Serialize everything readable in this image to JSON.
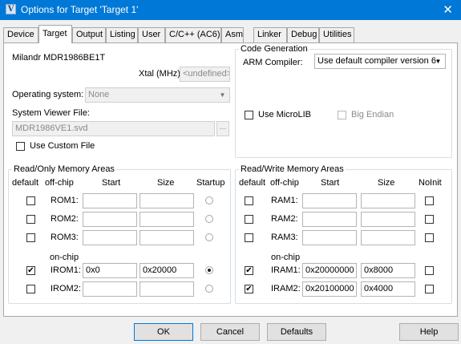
{
  "window": {
    "title": "Options for Target 'Target 1'",
    "close_glyph": "✕",
    "app_icon_letter": "V"
  },
  "tabs": [
    {
      "label": "Device",
      "active": false
    },
    {
      "label": "Target",
      "active": true
    },
    {
      "label": "Output",
      "active": false
    },
    {
      "label": "Listing",
      "active": false
    },
    {
      "label": "User",
      "active": false
    },
    {
      "label": "C/C++ (AC6)",
      "active": false
    },
    {
      "label": "Asm",
      "active": false
    },
    {
      "label": "Linker",
      "active": false
    },
    {
      "label": "Debug",
      "active": false
    },
    {
      "label": "Utilities",
      "active": false
    }
  ],
  "target": {
    "device_name": "Milandr MDR1986BE1T",
    "xtal_label": "Xtal (MHz):",
    "xtal_value": "<undefined>",
    "os_label": "Operating system:",
    "os_value": "None",
    "svd_label": "System Viewer File:",
    "svd_value": "MDR1986VE1.svd",
    "browse_label": "...",
    "use_custom_file_label": "Use Custom File",
    "use_custom_file_checked": false
  },
  "code_generation": {
    "title": "Code Generation",
    "compiler_label": "ARM Compiler:",
    "compiler_value": "Use default compiler version 6",
    "use_microlib_label": "Use MicroLIB",
    "use_microlib_checked": false,
    "big_endian_label": "Big Endian",
    "big_endian_checked": false
  },
  "rom_areas": {
    "title": "Read/Only Memory Areas",
    "headers": {
      "default": "default",
      "offchip": "off-chip",
      "start": "Start",
      "size": "Size",
      "startup": "Startup"
    },
    "on_chip_label": "on-chip",
    "rows": [
      {
        "name": "ROM1:",
        "checked": false,
        "start": "",
        "size": "",
        "startup": false
      },
      {
        "name": "ROM2:",
        "checked": false,
        "start": "",
        "size": "",
        "startup": false
      },
      {
        "name": "ROM3:",
        "checked": false,
        "start": "",
        "size": "",
        "startup": false
      },
      {
        "name": "IROM1:",
        "checked": true,
        "start": "0x0",
        "size": "0x20000",
        "startup": true
      },
      {
        "name": "IROM2:",
        "checked": false,
        "start": "",
        "size": "",
        "startup": false
      }
    ]
  },
  "ram_areas": {
    "title": "Read/Write Memory Areas",
    "headers": {
      "default": "default",
      "offchip": "off-chip",
      "start": "Start",
      "size": "Size",
      "noinit": "NoInit"
    },
    "on_chip_label": "on-chip",
    "rows": [
      {
        "name": "RAM1:",
        "checked": false,
        "start": "",
        "size": "",
        "noinit": false
      },
      {
        "name": "RAM2:",
        "checked": false,
        "start": "",
        "size": "",
        "noinit": false
      },
      {
        "name": "RAM3:",
        "checked": false,
        "start": "",
        "size": "",
        "noinit": false
      },
      {
        "name": "IRAM1:",
        "checked": true,
        "start": "0x20000000",
        "size": "0x8000",
        "noinit": false
      },
      {
        "name": "IRAM2:",
        "checked": true,
        "start": "0x20100000",
        "size": "0x4000",
        "noinit": false
      }
    ]
  },
  "buttons": {
    "ok": "OK",
    "cancel": "Cancel",
    "defaults": "Defaults",
    "help": "Help"
  },
  "glyphs": {
    "check": "✔",
    "combo_arrow": "▼"
  }
}
